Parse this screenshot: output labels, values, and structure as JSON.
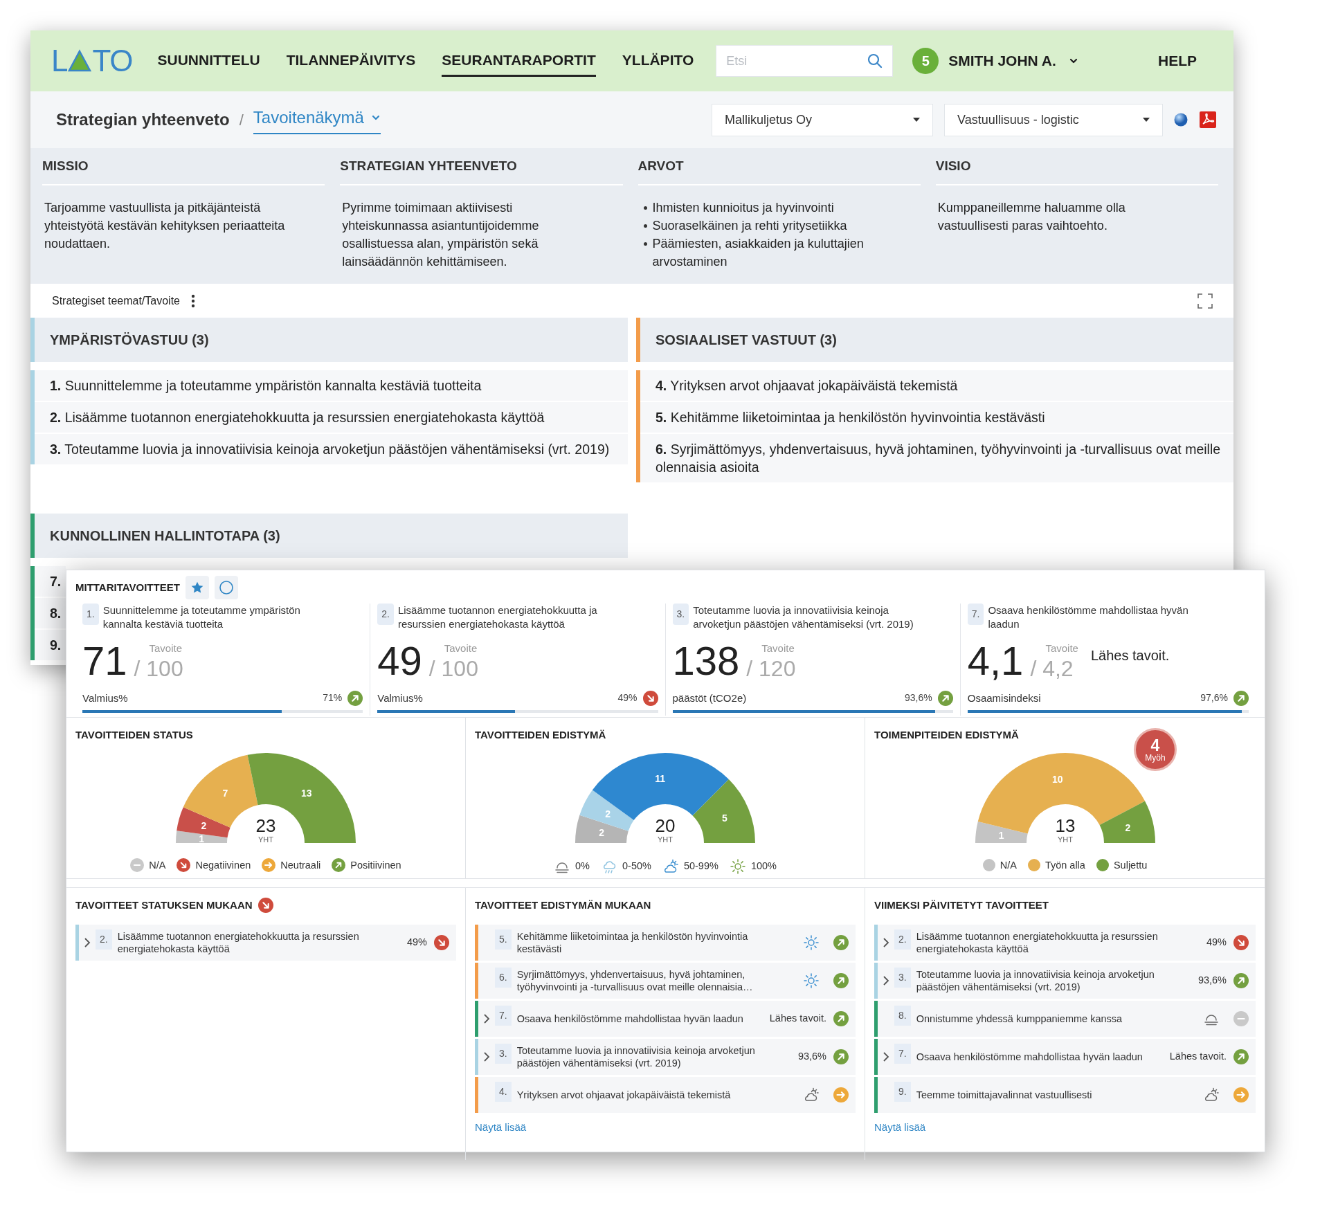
{
  "header": {
    "logo": {
      "left": "L",
      "right": "TO"
    },
    "nav": [
      {
        "label": "SUUNNITTELU",
        "selected": false
      },
      {
        "label": "TILANNEPÄIVITYS",
        "selected": false
      },
      {
        "label": "SEURANTARAPORTIT",
        "selected": true
      },
      {
        "label": "YLLÄPITO",
        "selected": false
      }
    ],
    "search": {
      "placeholder": "Etsi"
    },
    "notifications": "5",
    "user": "SMITH JOHN A.",
    "help": "HELP"
  },
  "breadcrumb": {
    "parent": "Strategian yhteenveto",
    "separator": "/",
    "current": "Tavoitenäkymä"
  },
  "filters": [
    "Mallikuljetus Oy",
    "Vastuullisuus - logistic"
  ],
  "summary": [
    {
      "heading": "MISSIO",
      "text": "Tarjoamme vastuullista ja pitkäjänteistä yhteistyötä kestävän kehityksen periaatteita noudattaen."
    },
    {
      "heading": "STRATEGIAN YHTEENVETO",
      "text": "Pyrimme toimimaan aktiivisesti yhteiskunnassa asiantuntijoidemme osallistuessa alan, ympäristön sekä lainsäädännön kehittämiseen."
    },
    {
      "heading": "ARVOT",
      "items": [
        "Ihmisten kunnioitus ja hyvinvointi",
        "Suoraselkäinen ja rehti yritysetiikka",
        "Päämiesten, asiakkaiden ja kuluttajien arvostaminen"
      ]
    },
    {
      "heading": "VISIO",
      "text": "Kumppaneillemme haluamme olla vastuullisesti paras vaihtoehto."
    }
  ],
  "themes_toolbar": {
    "label": "Strategiset teemat/Tavoite"
  },
  "themes": [
    {
      "title": "YMPÄRISTÖVASTUU (3)",
      "color": "#a9d3e3",
      "goals": [
        {
          "number": "1.",
          "text": "Suunnittelemme ja toteutamme ympäristön kannalta kestäviä tuotteita"
        },
        {
          "number": "2.",
          "text": "Lisäämme tuotannon energiatehokkuutta ja resurssien energiatehokasta käyttöä"
        },
        {
          "number": "3.",
          "text": "Toteutamme luovia ja innovatiivisia keinoja arvoketjun päästöjen vähentämiseksi (vrt. 2019)"
        }
      ]
    },
    {
      "title": "SOSIAALISET VASTUUT (3)",
      "color": "#f39c4a",
      "goals": [
        {
          "number": "4.",
          "text": "Yrityksen arvot ohjaavat jokapäiväistä tekemistä"
        },
        {
          "number": "5.",
          "text": "Kehitämme liiketoimintaa ja henkilöstön hyvinvointia kestävästi"
        },
        {
          "number": "6.",
          "text": "Syrjimättömyys, yhdenvertaisuus, hyvä johtaminen, työhyvinvointi ja -turvallisuus ovat meille olennaisia asioita"
        }
      ]
    },
    {
      "title": "KUNNOLLINEN HALLINTOTAPA (3)",
      "color": "#2e9e6e",
      "goals": [
        {
          "number": "7."
        },
        {
          "number": "8."
        },
        {
          "number": "9."
        }
      ]
    }
  ],
  "metrics": {
    "title": "MITTARITAVOITTEET",
    "cards": [
      {
        "number": "1.",
        "text": "Suunnittelemme ja toteutamme ympäristön kannalta kestäviä tuotteita",
        "value": "71",
        "target_label": "Tavoite",
        "target": "/ 100",
        "label": "Valmius%",
        "percent": "71%",
        "status_icon": {
          "kind": "positive"
        },
        "level": 0.71
      },
      {
        "number": "2.",
        "text": "Lisäämme tuotannon energiatehokkuutta ja resurssien energiatehokasta käyttöä",
        "value": "49",
        "target_label": "Tavoite",
        "target": "/ 100",
        "label": "Valmius%",
        "percent": "49%",
        "status_icon": {
          "kind": "negative"
        },
        "level": 0.49
      },
      {
        "number": "3.",
        "text": "Toteutamme luovia ja innovatiivisia keinoja arvoketjun päästöjen vähentämiseksi (vrt. 2019)",
        "value": "138",
        "target_label": "Tavoite",
        "target": "/ 120",
        "label": "päästöt (tCO2e)",
        "percent": "93,6%",
        "status_icon": {
          "kind": "positive"
        },
        "level": 0.936
      },
      {
        "number": "7.",
        "text": "Osaava henkilöstömme mahdollistaa hyvän laadun",
        "value": "4,1",
        "target_label": "Tavoite",
        "target": "/ 4,2",
        "note": "Lähes tavoit.",
        "label": "Osaamisindeksi",
        "percent": "97,6%",
        "status_icon": {
          "kind": "positive"
        },
        "level": 0.976
      }
    ]
  },
  "charts": [
    {
      "total": "23",
      "total_label": "YHT",
      "markers": [
        {
          "kind": "na"
        },
        {
          "kind": "negative"
        },
        {
          "kind": "neutral"
        },
        {
          "kind": "positive"
        }
      ],
      "chart_data": {
        "type": "donut",
        "title": "TAVOITTEIDEN STATUS",
        "categories": [
          "N/A",
          "Negatiivinen",
          "Neutraali",
          "Positiivinen"
        ],
        "values": [
          1,
          2,
          7,
          13
        ],
        "data_labels": true
      }
    },
    {
      "total": "20",
      "total_label": "YHT",
      "markers": [
        {
          "kind": "fog"
        },
        {
          "kind": "rain"
        },
        {
          "kind": "cloud-sun"
        },
        {
          "kind": "sun"
        }
      ],
      "chart_data": {
        "type": "donut",
        "title": "TAVOITTEIDEN EDISTYMÄ",
        "categories": [
          "0%",
          "0-50%",
          "50-99%",
          "100%"
        ],
        "values": [
          2,
          2,
          11,
          5
        ],
        "data_labels": true
      }
    },
    {
      "total": "13",
      "total_label": "YHT",
      "markers": [
        {
          "kind": "none"
        },
        {
          "kind": "in-progress"
        },
        {
          "kind": "closed"
        }
      ],
      "badge": {
        "value": "4",
        "label": "Myöh"
      },
      "chart_data": {
        "type": "donut",
        "title": "TOIMENPITEIDEN EDISTYMÄ",
        "categories": [
          "N/A",
          "Työn alla",
          "Suljettu"
        ],
        "values": [
          1,
          10,
          2
        ],
        "data_labels": true
      }
    }
  ],
  "lists": [
    {
      "title": "TAVOITTEET STATUKSEN MUKAAN",
      "status_icon": {
        "kind": "negative"
      },
      "items": [
        {
          "color": "#a9d3e3",
          "expandable": true,
          "number": "2.",
          "text": "Lisäämme tuotannon energiatehokkuutta ja resurssien energiatehokasta käyttöä",
          "value": "49%",
          "status_icon": {
            "kind": "negative"
          }
        }
      ]
    },
    {
      "title": "TAVOITTEET EDISTYMÄN MUKAAN",
      "more": "Näytä lisää",
      "items": [
        {
          "color": "#f39c4a",
          "expandable": false,
          "number": "5.",
          "text": "Kehitämme liiketoimintaa ja henkilöstön hyvinvointia kestävästi",
          "weather_icon": {
            "kind": "sun"
          },
          "status_icon": {
            "kind": "positive"
          }
        },
        {
          "color": "#f39c4a",
          "expandable": false,
          "number": "6.",
          "text": "Syrjimättömyys, yhdenvertaisuus, hyvä johtaminen, työhyvinvointi ja -turvallisuus ovat meille olennaisia…",
          "weather_icon": {
            "kind": "sun"
          },
          "status_icon": {
            "kind": "positive"
          }
        },
        {
          "color": "#2e9e6e",
          "expandable": true,
          "number": "7.",
          "text": "Osaava henkilöstömme mahdollistaa hyvän laadun",
          "value": "Lähes tavoit.",
          "status_icon": {
            "kind": "positive"
          }
        },
        {
          "color": "#a9d3e3",
          "expandable": true,
          "number": "3.",
          "text": "Toteutamme luovia ja innovatiivisia keinoja arvoketjun päästöjen vähentämiseksi (vrt. 2019)",
          "value": "93,6%",
          "status_icon": {
            "kind": "positive"
          }
        },
        {
          "color": "#f39c4a",
          "expandable": false,
          "number": "4.",
          "text": "Yrityksen arvot ohjaavat jokapäiväistä tekemistä",
          "weather_icon": {
            "kind": "cloud-sun"
          },
          "status_icon": {
            "kind": "neutral"
          }
        }
      ]
    },
    {
      "title": "VIIMEKSI PÄIVITETYT TAVOITTEET",
      "more": "Näytä lisää",
      "items": [
        {
          "color": "#a9d3e3",
          "expandable": true,
          "number": "2.",
          "text": "Lisäämme tuotannon energiatehokkuutta ja resurssien energiatehokasta käyttöä",
          "value": "49%",
          "status_icon": {
            "kind": "negative"
          }
        },
        {
          "color": "#a9d3e3",
          "expandable": true,
          "number": "3.",
          "text": "Toteutamme luovia ja innovatiivisia keinoja arvoketjun päästöjen vähentämiseksi (vrt. 2019)",
          "value": "93,6%",
          "status_icon": {
            "kind": "positive"
          }
        },
        {
          "color": "#2e9e6e",
          "expandable": false,
          "number": "8.",
          "text": "Onnistumme yhdessä kumppaniemme kanssa",
          "weather_icon": {
            "kind": "fog"
          },
          "status_icon": {
            "kind": "na"
          }
        },
        {
          "color": "#2e9e6e",
          "expandable": true,
          "number": "7.",
          "text": "Osaava henkilöstömme mahdollistaa hyvän laadun",
          "value": "Lähes tavoit.",
          "status_icon": {
            "kind": "positive"
          }
        },
        {
          "color": "#2e9e6e",
          "expandable": false,
          "number": "9.",
          "text": "Teemme toimittajavalinnat vastuullisesti",
          "weather_icon": {
            "kind": "cloud-sun"
          },
          "status_icon": {
            "kind": "neutral"
          }
        }
      ]
    }
  ]
}
